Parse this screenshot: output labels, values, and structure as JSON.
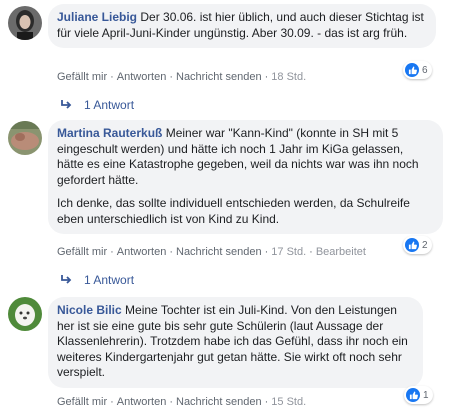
{
  "comments": [
    {
      "author": "Juliane Liebig",
      "paragraphs": [
        "Der 30.06. ist hier üblich, und auch dieser Stichtag ist für viele April-Juni-Kinder ungünstig. Aber 30.09. - das ist arg früh."
      ],
      "actions": {
        "like": "Gefällt mir",
        "reply": "Antworten",
        "message": "Nachricht senden",
        "time": "18 Std.",
        "edited": ""
      },
      "reactions": "6",
      "reply_count": "1 Antwort",
      "avatar": "avatar-juliane"
    },
    {
      "author": "Martina Rauterkuß",
      "paragraphs": [
        "Meiner war \"Kann-Kind\" (konnte in SH mit 5 eingeschult werden) und hätte ich noch 1 Jahr im KiGa gelassen, hätte es eine Katastrophe gegeben, weil da nichts war was ihn noch gefordert hätte.",
        "Ich denke, das sollte individuell entschieden werden, da Schulreife eben unterschiedlich ist von Kind zu Kind."
      ],
      "actions": {
        "like": "Gefällt mir",
        "reply": "Antworten",
        "message": "Nachricht senden",
        "time": "17 Std.",
        "edited": "Bearbeitet"
      },
      "reactions": "2",
      "reply_count": "1 Antwort",
      "avatar": "avatar-martina"
    },
    {
      "author": "Nicole Bilic",
      "paragraphs": [
        "Meine Tochter ist ein Juli-Kind. Von den Leistungen her ist sie eine gute bis sehr gute Schülerin (laut Aussage der Klassenlehrerin). Trotzdem habe ich das Gefühl, dass ihr noch ein weiteres Kindergartenjahr gut getan hätte. Sie wirkt oft noch sehr verspielt."
      ],
      "actions": {
        "like": "Gefällt mir",
        "reply": "Antworten",
        "message": "Nachricht senden",
        "time": "15 Std.",
        "edited": ""
      },
      "reactions": "1",
      "avatar": "avatar-nicole"
    }
  ],
  "colors": {
    "author": "#385898",
    "bubble": "#f2f3f5",
    "like_blue": "#1877f2"
  },
  "icons": {
    "reply_arrow": "reply-arrow-icon",
    "like": "like-thumb-icon"
  }
}
